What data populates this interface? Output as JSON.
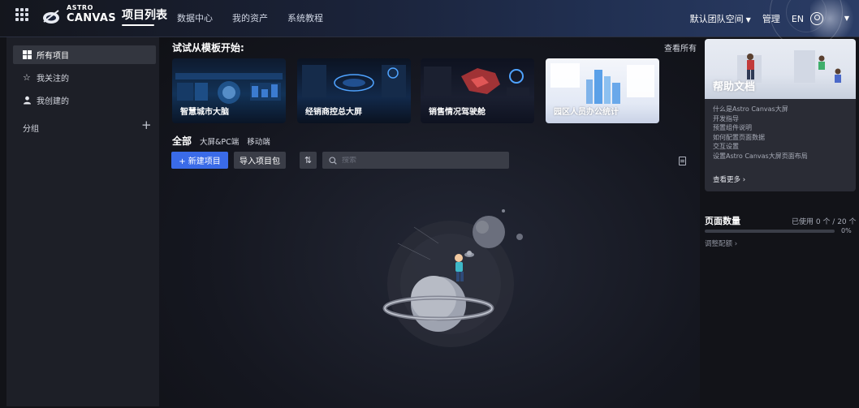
{
  "header": {
    "logo_small": "ASTRO",
    "logo_big": "CANVAS",
    "title": "项目列表",
    "nav": [
      "数据中心",
      "我的资产",
      "系统教程"
    ],
    "team": "默认团队空间",
    "manage": "管理",
    "lang": "EN"
  },
  "sidebar": {
    "items": [
      {
        "label": "所有项目",
        "icon": "grid-icon"
      },
      {
        "label": "我关注的",
        "icon": "star-icon"
      },
      {
        "label": "我创建的",
        "icon": "user-icon"
      }
    ],
    "group": "分组"
  },
  "main": {
    "try_title": "试试从模板开始:",
    "view_all": "查看所有",
    "templates": [
      "智慧城市大脑",
      "经销商控总大屏",
      "销售情况驾驶舱",
      "园区人员办公统计"
    ],
    "tabs": [
      "全部",
      "大屏&PC端",
      "移动端"
    ],
    "new_btn": "+ 新建项目",
    "import_btn": "导入项目包",
    "search_placeholder": "搜索"
  },
  "help": {
    "title": "帮助文档",
    "links": [
      "什么是Astro Canvas大屏",
      "开发指导",
      "预置组件说明",
      "如何配置页面数据",
      "交互设置",
      "设置Astro Canvas大屏页面布局"
    ],
    "more": "查看更多 ›"
  },
  "quota": {
    "title": "页面数量",
    "used": "已使用 0 个 / 20 个",
    "percent": 0,
    "percent_label": "0%",
    "adjust": "调整配额 ›"
  },
  "colors": {
    "accent": "#3a6be8",
    "background": "#121318"
  }
}
